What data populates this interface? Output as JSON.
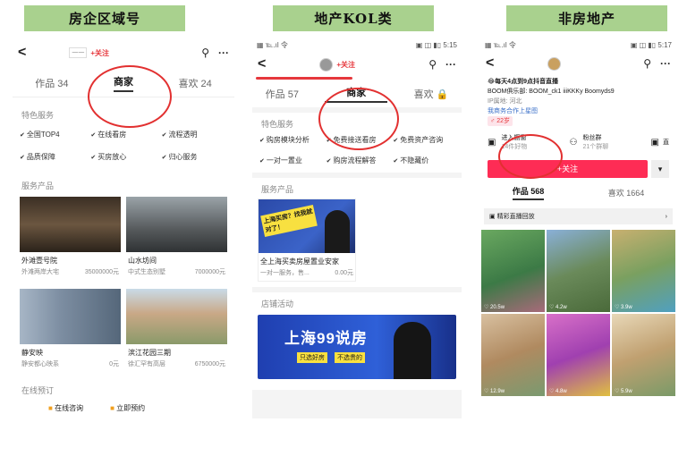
{
  "labels": {
    "l1": "房企区域号",
    "l2": "地产KOL类",
    "l3": "非房地产"
  },
  "p1": {
    "follow": "+关注",
    "logo": "一一",
    "tabs": [
      "作品 34",
      "商家",
      "喜欢 24"
    ],
    "services_title": "特色服务",
    "services": [
      "全国TOP4",
      "在线看房",
      "流程透明",
      "品质保障",
      "买房放心",
      "归心服务"
    ],
    "products_title": "服务产品",
    "products": [
      {
        "name": "外滩壹号院",
        "desc": "外滩两岸大宅",
        "price": "35000000元"
      },
      {
        "name": "山水坊间",
        "desc": "中式生态别墅",
        "price": "7000000元"
      },
      {
        "name": "静安映",
        "desc": "静安都心映系",
        "price": "0元"
      },
      {
        "name": "滨江花园三期",
        "desc": "徐汇罕有高层",
        "price": "6750000元"
      }
    ],
    "booking_title": "在线预订",
    "booking_items": [
      "在线咨询",
      "立即预约"
    ]
  },
  "p2": {
    "status_left": "▦ ℡.ıl 令",
    "status_right": "▣ ◫ ▮▯ 5:15",
    "follow": "+关注",
    "tabs": [
      "作品 57",
      "商家",
      "喜欢 🔒"
    ],
    "services_title": "特色服务",
    "services": [
      "购房模块分析",
      "免费接送看房",
      "免费资产咨询",
      "一对一置业",
      "购房流程解答",
      "不隐藏价"
    ],
    "products_title": "服务产品",
    "poster_text": "上海买房？找我就对了！",
    "product_name": "全上海买卖房屋置业安家",
    "product_desc": "一对一服务，售...",
    "product_price": "0.00元",
    "events_title": "店铺活动",
    "banner_title": "上海99说房",
    "banner_sub1": "只选好房",
    "banner_sub2": "不选贵的"
  },
  "p3": {
    "status_left": "▦ ℡.ıl 令",
    "status_right": "▣ ◫ ▮▯ 5:17",
    "bio1": "😂每天4点到9点抖音直播",
    "bio2": "BOOM俱乐部: BOOM_ck1  iiiKKKy  Boomyds9",
    "bio3": "IP属地: 河北",
    "bio_link": "我商务合作上星图",
    "tag": "♂ 22岁",
    "shop_label": "进入橱窗",
    "shop_sub": "14件好物",
    "fans_label": "粉丝群",
    "fans_sub": "21个群聊",
    "extra_label": "直",
    "follow_btn": "+关注",
    "dropdown": "▾",
    "tabs": [
      "作品 568",
      "喜欢 1664"
    ],
    "replay": "精彩直播回放",
    "videos": [
      {
        "views": "♡ 20.5w"
      },
      {
        "views": "♡ 4.2w"
      },
      {
        "views": "♡ 3.9w"
      },
      {
        "views": "♡ 12.9w"
      },
      {
        "views": "♡ 4.8w"
      },
      {
        "views": "♡ 5.9w"
      }
    ]
  }
}
